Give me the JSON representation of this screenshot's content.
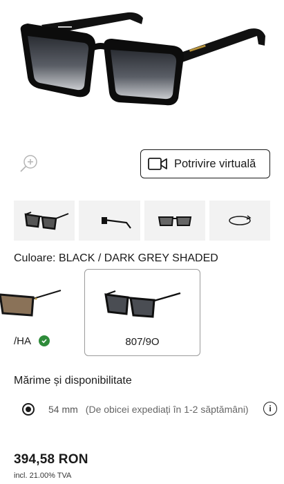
{
  "product": {
    "hero_image": "black-square-sunglasses-dark-grey-shaded-lenses"
  },
  "gallery": {
    "zoom_icon": "zoom-in-icon",
    "virtual_try_on_icon": "video-camera-icon",
    "virtual_try_on_label": "Potrivire virtuală",
    "thumbnails": [
      "front-view",
      "side-view",
      "top-view",
      "360-rotate-icon"
    ]
  },
  "color": {
    "label": "Culoare:",
    "value": "BLACK / DARK GREY SHADED",
    "variants": [
      {
        "code": "/HA",
        "available": true,
        "check_color": "#2e8b3a",
        "selected": false
      },
      {
        "code": "807/9O",
        "selected": true
      }
    ]
  },
  "size": {
    "title": "Mărime și disponibilitate",
    "option": "54 mm",
    "availability": "(De obicei expediați în 1-2 săptămâni)",
    "info_icon": "info-icon"
  },
  "pricing": {
    "price": "394,58 RON",
    "vat_note": "incl. 21.00% TVA"
  }
}
